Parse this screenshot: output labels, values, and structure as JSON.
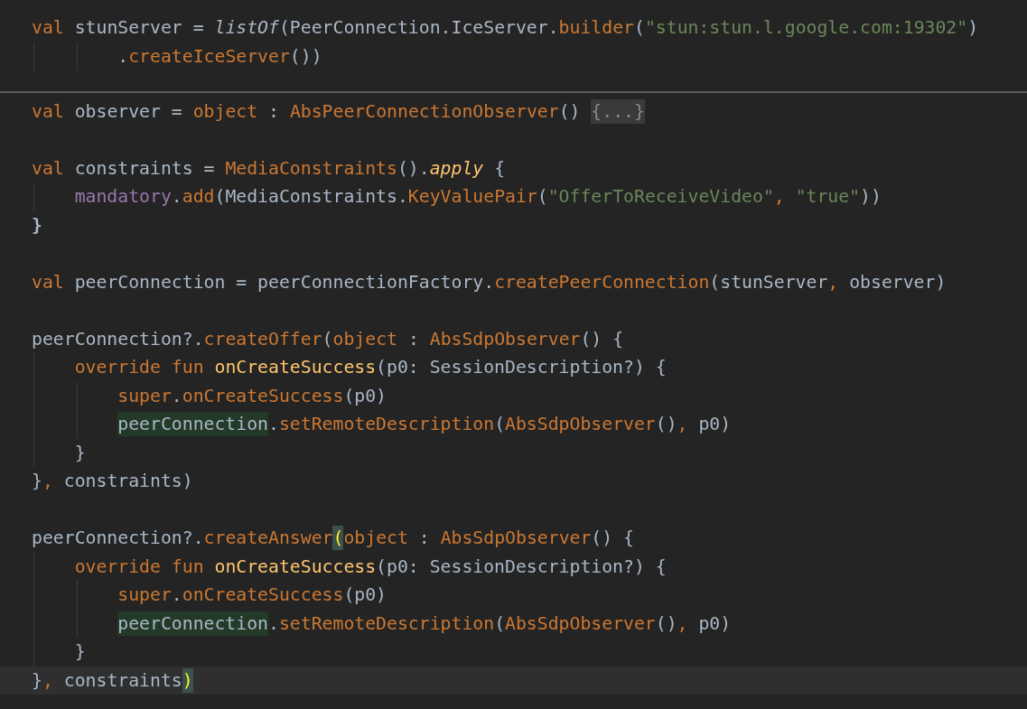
{
  "editor": {
    "lines": [
      {
        "kind": "code",
        "tokens": [
          {
            "text": "val",
            "kind": "keyword"
          },
          {
            "text": " stunServer = ",
            "kind": "plain"
          },
          {
            "text": "listOf",
            "kind": "italic"
          },
          {
            "text": "(PeerConnection.IceServer.",
            "kind": "plain"
          },
          {
            "text": "builder",
            "kind": "call"
          },
          {
            "text": "(",
            "kind": "plain"
          },
          {
            "text": "\"stun:stun.l.google.com:19302\"",
            "kind": "string"
          },
          {
            "text": ")",
            "kind": "plain"
          }
        ]
      },
      {
        "kind": "code",
        "tokens": [
          {
            "text": "        .",
            "kind": "plain"
          },
          {
            "text": "createIceServer",
            "kind": "call"
          },
          {
            "text": "())",
            "kind": "plain"
          }
        ]
      },
      {
        "kind": "separator"
      },
      {
        "kind": "code",
        "tokens": [
          {
            "text": "val",
            "kind": "keyword"
          },
          {
            "text": " observer = ",
            "kind": "plain"
          },
          {
            "text": "object",
            "kind": "keyword"
          },
          {
            "text": " : ",
            "kind": "plain"
          },
          {
            "text": "AbsPeerConnectionObserver",
            "kind": "call"
          },
          {
            "text": "() ",
            "kind": "plain"
          },
          {
            "text": "{...}",
            "kind": "fold"
          }
        ]
      },
      {
        "kind": "blank"
      },
      {
        "kind": "code",
        "tokens": [
          {
            "text": "val",
            "kind": "keyword"
          },
          {
            "text": " constraints = ",
            "kind": "plain"
          },
          {
            "text": "MediaConstraints",
            "kind": "call"
          },
          {
            "text": "().",
            "kind": "plain"
          },
          {
            "text": "apply",
            "kind": "italic-call"
          },
          {
            "text": " {",
            "kind": "plain"
          }
        ]
      },
      {
        "kind": "code",
        "tokens": [
          {
            "text": "    mandatory",
            "kind": "field"
          },
          {
            "text": ".",
            "kind": "plain"
          },
          {
            "text": "add",
            "kind": "call"
          },
          {
            "text": "(MediaConstraints.",
            "kind": "plain"
          },
          {
            "text": "KeyValuePair",
            "kind": "call"
          },
          {
            "text": "(",
            "kind": "plain"
          },
          {
            "text": "\"OfferToReceiveVideo\"",
            "kind": "string"
          },
          {
            "text": ", ",
            "kind": "keyword"
          },
          {
            "text": "\"true\"",
            "kind": "string"
          },
          {
            "text": "))",
            "kind": "plain"
          }
        ]
      },
      {
        "kind": "code",
        "tokens": [
          {
            "text": "}",
            "kind": "bold"
          }
        ]
      },
      {
        "kind": "blank"
      },
      {
        "kind": "code",
        "tokens": [
          {
            "text": "val",
            "kind": "keyword"
          },
          {
            "text": " peerConnection = peerConnectionFactory.",
            "kind": "plain"
          },
          {
            "text": "createPeerConnection",
            "kind": "call"
          },
          {
            "text": "(stunServer",
            "kind": "plain"
          },
          {
            "text": ", ",
            "kind": "keyword"
          },
          {
            "text": "observer)",
            "kind": "plain"
          }
        ]
      },
      {
        "kind": "blank"
      },
      {
        "kind": "code",
        "tokens": [
          {
            "text": "peerConnection?.",
            "kind": "plain"
          },
          {
            "text": "createOffer",
            "kind": "call"
          },
          {
            "text": "(",
            "kind": "plain"
          },
          {
            "text": "object",
            "kind": "keyword"
          },
          {
            "text": " : ",
            "kind": "plain"
          },
          {
            "text": "AbsSdpObserver",
            "kind": "call"
          },
          {
            "text": "() {",
            "kind": "plain"
          }
        ]
      },
      {
        "kind": "code",
        "tokens": [
          {
            "text": "    override fun ",
            "kind": "keyword"
          },
          {
            "text": "onCreateSuccess",
            "kind": "declaration"
          },
          {
            "text": "(p0: SessionDescription?) {",
            "kind": "plain"
          }
        ]
      },
      {
        "kind": "code",
        "tokens": [
          {
            "text": "        super",
            "kind": "keyword"
          },
          {
            "text": ".",
            "kind": "plain"
          },
          {
            "text": "onCreateSuccess",
            "kind": "call"
          },
          {
            "text": "(p0)",
            "kind": "plain"
          }
        ]
      },
      {
        "kind": "code",
        "tokens": [
          {
            "text": "        peerConnection",
            "kind": "usage"
          },
          {
            "text": ".",
            "kind": "plain"
          },
          {
            "text": "setRemoteDescription",
            "kind": "call"
          },
          {
            "text": "(",
            "kind": "plain"
          },
          {
            "text": "AbsSdpObserver",
            "kind": "call"
          },
          {
            "text": "()",
            "kind": "plain"
          },
          {
            "text": ", ",
            "kind": "keyword"
          },
          {
            "text": "p0)",
            "kind": "plain"
          }
        ]
      },
      {
        "kind": "code",
        "tokens": [
          {
            "text": "    }",
            "kind": "plain"
          }
        ]
      },
      {
        "kind": "code",
        "tokens": [
          {
            "text": "}",
            "kind": "plain"
          },
          {
            "text": ", ",
            "kind": "keyword"
          },
          {
            "text": "constraints)",
            "kind": "plain"
          }
        ]
      },
      {
        "kind": "blank"
      },
      {
        "kind": "code",
        "tokens": [
          {
            "text": "peerConnection?.",
            "kind": "plain"
          },
          {
            "text": "createAnswer",
            "kind": "call"
          },
          {
            "text": "(",
            "kind": "brace-match"
          },
          {
            "text": "object",
            "kind": "keyword"
          },
          {
            "text": " : ",
            "kind": "plain"
          },
          {
            "text": "AbsSdpObserver",
            "kind": "call"
          },
          {
            "text": "() {",
            "kind": "plain"
          }
        ]
      },
      {
        "kind": "code",
        "tokens": [
          {
            "text": "    override fun ",
            "kind": "keyword"
          },
          {
            "text": "onCreateSuccess",
            "kind": "declaration"
          },
          {
            "text": "(p0: SessionDescription?) {",
            "kind": "plain"
          }
        ]
      },
      {
        "kind": "code",
        "tokens": [
          {
            "text": "        super",
            "kind": "keyword"
          },
          {
            "text": ".",
            "kind": "plain"
          },
          {
            "text": "onCreateSuccess",
            "kind": "call"
          },
          {
            "text": "(p0)",
            "kind": "plain"
          }
        ]
      },
      {
        "kind": "code",
        "tokens": [
          {
            "text": "        peerConnection",
            "kind": "usage"
          },
          {
            "text": ".",
            "kind": "plain"
          },
          {
            "text": "setRemoteDescription",
            "kind": "call"
          },
          {
            "text": "(",
            "kind": "plain"
          },
          {
            "text": "AbsSdpObserver",
            "kind": "call"
          },
          {
            "text": "()",
            "kind": "plain"
          },
          {
            "text": ", ",
            "kind": "keyword"
          },
          {
            "text": "p0)",
            "kind": "plain"
          }
        ]
      },
      {
        "kind": "code",
        "tokens": [
          {
            "text": "    }",
            "kind": "plain"
          }
        ]
      },
      {
        "kind": "current-line",
        "tokens": [
          {
            "text": "}",
            "kind": "plain"
          },
          {
            "text": ", ",
            "kind": "keyword"
          },
          {
            "text": "constraints",
            "kind": "plain"
          },
          {
            "text": ")",
            "kind": "brace-match"
          }
        ]
      }
    ]
  }
}
